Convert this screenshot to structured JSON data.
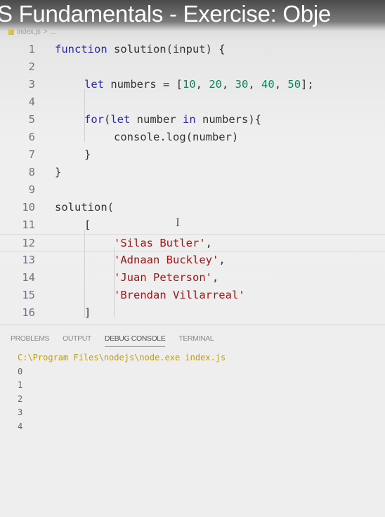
{
  "video_title": "S Fundamentals - Exercise: Obje",
  "breadcrumb": {
    "file": "index.js",
    "separator": ">",
    "rest": "..."
  },
  "editor": {
    "current_line": 12,
    "lines": [
      {
        "n": "1",
        "indent": 0,
        "tokens": [
          [
            "kw",
            "function"
          ],
          [
            "pl",
            " solution(input) {"
          ]
        ]
      },
      {
        "n": "2",
        "indent": 0,
        "tokens": []
      },
      {
        "n": "3",
        "indent": 1,
        "tokens": [
          [
            "kw",
            "let"
          ],
          [
            "pl",
            " numbers = ["
          ],
          [
            "num",
            "10"
          ],
          [
            "pl",
            ", "
          ],
          [
            "num",
            "20"
          ],
          [
            "pl",
            ", "
          ],
          [
            "num",
            "30"
          ],
          [
            "pl",
            ", "
          ],
          [
            "num",
            "40"
          ],
          [
            "pl",
            ", "
          ],
          [
            "num",
            "50"
          ],
          [
            "pl",
            "];"
          ]
        ]
      },
      {
        "n": "4",
        "indent": 0,
        "tokens": []
      },
      {
        "n": "5",
        "indent": 1,
        "tokens": [
          [
            "kw",
            "for"
          ],
          [
            "pl",
            "("
          ],
          [
            "kw",
            "let"
          ],
          [
            "pl",
            " number "
          ],
          [
            "kw",
            "in"
          ],
          [
            "pl",
            " numbers){"
          ]
        ]
      },
      {
        "n": "6",
        "indent": 2,
        "tokens": [
          [
            "pl",
            "console.log(number)"
          ]
        ]
      },
      {
        "n": "7",
        "indent": 1,
        "tokens": [
          [
            "pl",
            "}"
          ]
        ]
      },
      {
        "n": "8",
        "indent": 0,
        "tokens": [
          [
            "pl",
            "}"
          ]
        ]
      },
      {
        "n": "9",
        "indent": 0,
        "tokens": []
      },
      {
        "n": "10",
        "indent": 0,
        "tokens": [
          [
            "pl",
            "solution("
          ]
        ]
      },
      {
        "n": "11",
        "indent": 1,
        "tokens": [
          [
            "pl",
            "["
          ]
        ]
      },
      {
        "n": "12",
        "indent": 2,
        "tokens": [
          [
            "str",
            "'Silas Butler'"
          ],
          [
            "pl",
            ","
          ]
        ]
      },
      {
        "n": "13",
        "indent": 2,
        "tokens": [
          [
            "str",
            "'Adnaan Buckley'"
          ],
          [
            "pl",
            ","
          ]
        ]
      },
      {
        "n": "14",
        "indent": 2,
        "tokens": [
          [
            "str",
            "'Juan Peterson'"
          ],
          [
            "pl",
            ","
          ]
        ]
      },
      {
        "n": "15",
        "indent": 2,
        "tokens": [
          [
            "str",
            "'Brendan Villarreal'"
          ]
        ]
      },
      {
        "n": "16",
        "indent": 1,
        "tokens": [
          [
            "pl",
            "]"
          ]
        ]
      }
    ]
  },
  "panel": {
    "tabs": [
      {
        "label": "PROBLEMS",
        "active": false
      },
      {
        "label": "OUTPUT",
        "active": false
      },
      {
        "label": "DEBUG CONSOLE",
        "active": true
      },
      {
        "label": "TERMINAL",
        "active": false
      }
    ],
    "console": {
      "command": "C:\\Program Files\\nodejs\\node.exe index.js",
      "output": [
        "0",
        "1",
        "2",
        "3",
        "4"
      ]
    }
  },
  "colors": {
    "keyword": "#2a2aa8",
    "string": "#a31515",
    "number": "#098658",
    "console_command": "#b89a2a"
  },
  "icons": {
    "file": "js-file-icon",
    "cursor": "text-cursor-icon"
  }
}
